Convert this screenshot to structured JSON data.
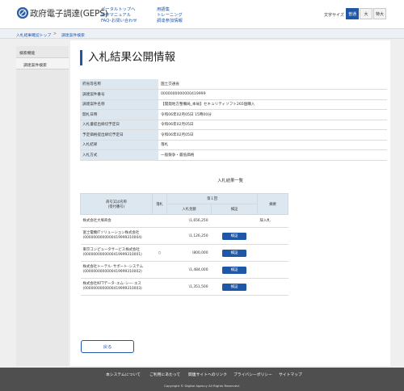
{
  "header": {
    "site_title": "政府電子調達(GEPS)",
    "links": {
      "portal_top": "ポータルトップへ",
      "manual": "操作マニュアル",
      "faq": "FAQ･お問い合わせ",
      "glossary": "用語集",
      "training": "トレーニング",
      "bid_info": "調達参加情報"
    },
    "font_size_label": "文字サイズ",
    "font_sizes": [
      "普通",
      "大",
      "特大"
    ],
    "font_size_selected": "普通"
  },
  "breadcrumb": {
    "top": "入札結果確認トップ",
    "separator": ">",
    "current": "調達案件検索"
  },
  "sidebar": {
    "heading": "検索機能",
    "items": [
      "調達案件検索"
    ]
  },
  "main": {
    "title": "入札結果公開情報",
    "info_rows": [
      {
        "label": "府省等名称",
        "value": "国土交通省"
      },
      {
        "label": "調達案件番号",
        "value": "0000000000000419999"
      },
      {
        "label": "調達案件名称",
        "value": "【開発地方整備局_本局】セキュリティソフト265個購入"
      },
      {
        "label": "開札日時",
        "value": "令和06年02月05日 15時00分"
      },
      {
        "label": "入札書提出締切予定日",
        "value": "令和06年02月05日"
      },
      {
        "label": "予定価格提出締切予定日",
        "value": "令和06年02月05日"
      },
      {
        "label": "入札結果",
        "value": "落札"
      },
      {
        "label": "入札方式",
        "value": "一般競争・最低価格"
      }
    ],
    "results_title": "入札結果一覧",
    "results_headers": {
      "company": "商号又は名称",
      "company_sub": "(受付番号)",
      "award": "落札",
      "round": "第１回",
      "bid_amount": "入札金額",
      "verify": "検証",
      "remarks": "摘要"
    },
    "results": [
      {
        "name": "株式会社大塚商会",
        "number": "",
        "award": "",
        "amount": "\\1,656,250",
        "has_verify": false,
        "remarks": "辞入札"
      },
      {
        "name": "富士電機ITソリューション株式会社",
        "number": "(0000000000000419999310004)",
        "award": "",
        "amount": "\\1,126,250",
        "has_verify": true,
        "remarks": ""
      },
      {
        "name": "東京コンピュータサービス株式会社",
        "number": "(0000000000000419999310001)",
        "award": "○",
        "amount": "\\800,000",
        "has_verify": true,
        "remarks": ""
      },
      {
        "name": "株式会社トーテル･サポート･システム",
        "number": "(0000000000000419999310002)",
        "award": "",
        "amount": "\\1,484,000",
        "has_verify": true,
        "remarks": ""
      },
      {
        "name": "株式会社NTTデータ･エム･シー･エス",
        "number": "(0000000000000419999310003)",
        "award": "",
        "amount": "\\1,351,500",
        "has_verify": true,
        "remarks": ""
      }
    ],
    "verify_button": "検証",
    "back_button": "戻る"
  },
  "footer": {
    "links": [
      "本システムについて",
      "ご利用にあたって",
      "関連サイトへのリンク",
      "プライバシーポリシー",
      "サイトマップ"
    ],
    "copyright": "Copyright © Digital Agency All Rights Reserved."
  },
  "colors": {
    "accent": "#1e56a8",
    "label_bg": "#dde7f0",
    "footer_bg": "#4f4f4f"
  }
}
